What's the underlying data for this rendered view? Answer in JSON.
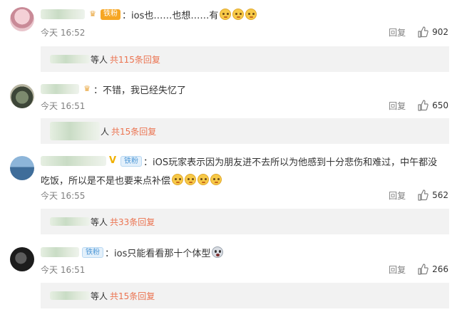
{
  "comments": [
    {
      "fan_badge": "铁粉",
      "text": "ios也……也想……有",
      "time": "今天 16:52",
      "reply_label": "回复",
      "likes": "902",
      "replies": {
        "suffix": "等人",
        "count_text": "共115条回复"
      }
    },
    {
      "text": "不错，我已经失忆了",
      "time": "今天 16:51",
      "reply_label": "回复",
      "likes": "650",
      "replies": {
        "suffix": "人",
        "count_text": "共15条回复"
      }
    },
    {
      "fan_badge": "铁粉",
      "text": "iOS玩家表示因为朋友进不去所以为他感到十分悲伤和难过，中午都没",
      "text_line2": "吃饭，所以是不是也要来点补偿",
      "time": "今天 16:55",
      "reply_label": "回复",
      "likes": "562",
      "replies": {
        "suffix": "等人",
        "count_text": "共33条回复"
      }
    },
    {
      "fan_badge": "铁粉",
      "text": "ios只能看看那十个体型",
      "time": "今天 16:51",
      "reply_label": "回复",
      "likes": "266",
      "replies": {
        "suffix": "等人",
        "count_text": "共15条回复"
      }
    }
  ],
  "icons": {
    "like": "thumbs-up-icon",
    "emoji_dog": "doge-emoji-icon",
    "emoji_scared": "scared-emoji-icon"
  },
  "colors": {
    "reply_count": "#eb7350",
    "reply_box_bg": "#f2f2f2",
    "meta_text": "#808080"
  }
}
